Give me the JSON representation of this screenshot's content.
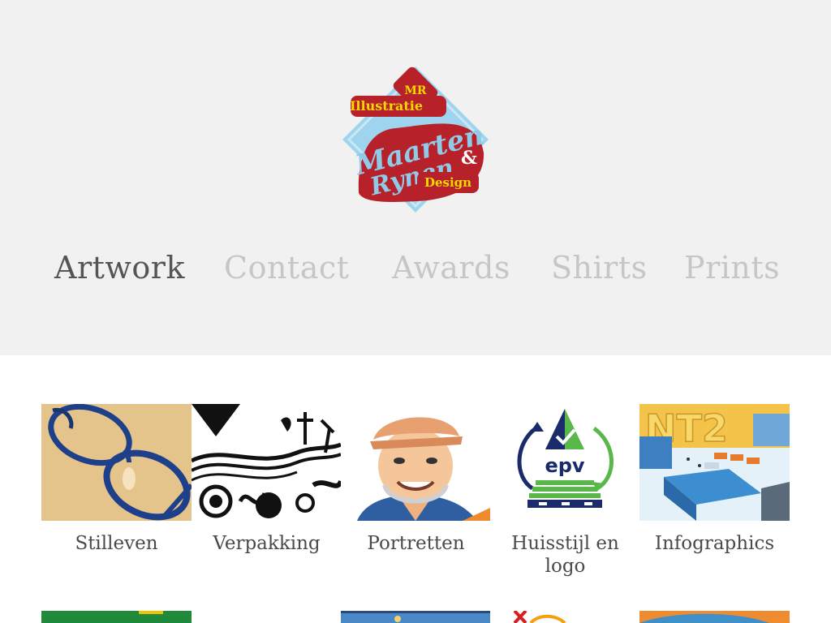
{
  "brand": {
    "logo_text_top": "Illustratie",
    "logo_text_main": "Maarten Rynen",
    "logo_text_amp": "&",
    "logo_text_bottom": "Design",
    "logo_monogram": "MR",
    "colors": {
      "red": "#b7212a",
      "blue": "#8fcbe8",
      "yellow": "#f4d800",
      "diamond": "#9fd4ee"
    }
  },
  "nav": {
    "items": [
      {
        "label": "Artwork",
        "active": true
      },
      {
        "label": "Contact",
        "active": false
      },
      {
        "label": "Awards",
        "active": false
      },
      {
        "label": "Shirts",
        "active": false
      },
      {
        "label": "Prints",
        "active": false
      }
    ]
  },
  "portfolio": {
    "categories": [
      {
        "label": "Stilleven",
        "icon": "glasses-illustration"
      },
      {
        "label": "Verpakking",
        "icon": "black-white-pattern-illustration"
      },
      {
        "label": "Portretten",
        "icon": "portrait-illustration"
      },
      {
        "label": "Huisstijl en logo",
        "icon": "epv-logo"
      },
      {
        "label": "Infographics",
        "icon": "city-infographic"
      }
    ],
    "epv_text": "epv",
    "nt2_text": "NT2"
  }
}
